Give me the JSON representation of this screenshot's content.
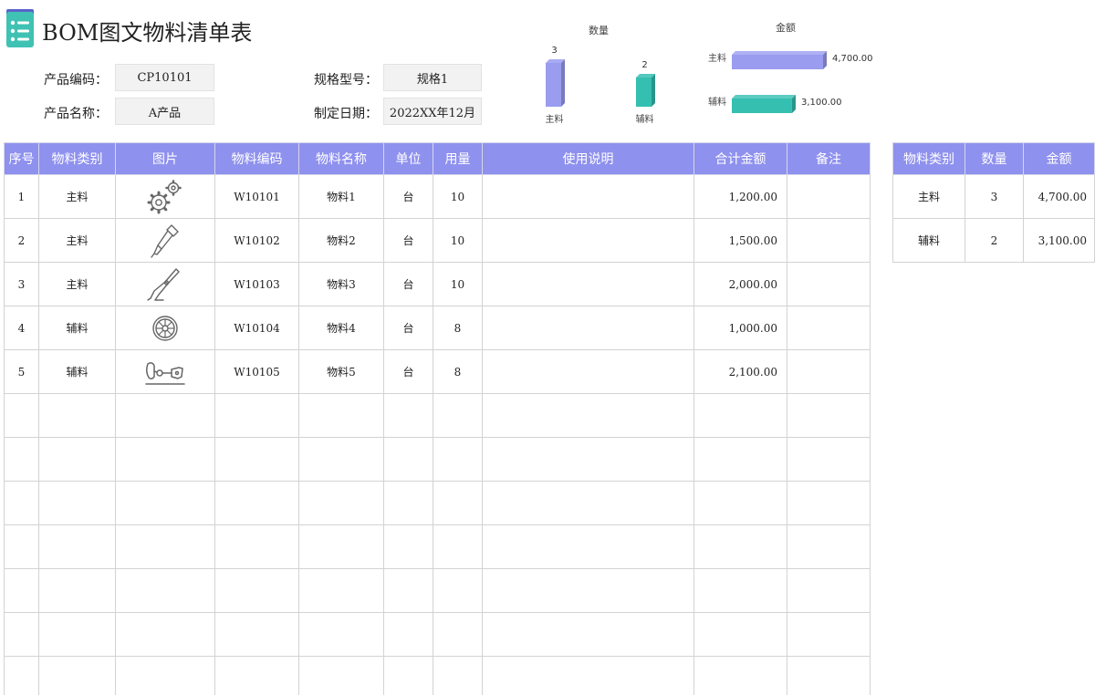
{
  "title": "BOM图文物料清单表",
  "info": {
    "product_code_label": "产品编码：",
    "product_code_value": "CP10101",
    "spec_label": "规格型号：",
    "spec_value": "规格1",
    "product_name_label": "产品名称：",
    "product_name_value": "A产品",
    "date_label": "制定日期：",
    "date_value": "2022XX年12月"
  },
  "colors": {
    "header": "#8f91ee",
    "series_main": "#9a9cf0",
    "series_aux": "#35bfb1"
  },
  "chart_data": [
    {
      "type": "bar",
      "title": "数量",
      "categories": [
        "主料",
        "辅料"
      ],
      "values": [
        3,
        2
      ],
      "data_labels": [
        "3",
        "2"
      ],
      "ylim": [
        0,
        3
      ]
    },
    {
      "type": "bar",
      "orientation": "horizontal",
      "title": "金额",
      "categories": [
        "主料",
        "辅料"
      ],
      "values": [
        4700,
        3100
      ],
      "data_labels": [
        "4,700.00",
        "3,100.00"
      ],
      "xlim": [
        0,
        4700
      ]
    }
  ],
  "table": {
    "headers": [
      "序号",
      "物料类别",
      "图片",
      "物料编码",
      "物料名称",
      "单位",
      "用量",
      "使用说明",
      "合计金额",
      "备注"
    ],
    "rows": [
      {
        "no": "1",
        "category": "主料",
        "icon": "gears-icon",
        "code": "W10101",
        "name": "物料1",
        "unit": "台",
        "qty": "10",
        "desc": "",
        "amount": "1,200.00",
        "note": ""
      },
      {
        "no": "2",
        "category": "主料",
        "icon": "pen-tool-icon",
        "code": "W10102",
        "name": "物料2",
        "unit": "台",
        "qty": "10",
        "desc": "",
        "amount": "1,500.00",
        "note": ""
      },
      {
        "no": "3",
        "category": "主料",
        "icon": "pliers-icon",
        "code": "W10103",
        "name": "物料3",
        "unit": "台",
        "qty": "10",
        "desc": "",
        "amount": "2,000.00",
        "note": ""
      },
      {
        "no": "4",
        "category": "辅料",
        "icon": "wheel-icon",
        "code": "W10104",
        "name": "物料4",
        "unit": "台",
        "qty": "8",
        "desc": "",
        "amount": "1,000.00",
        "note": ""
      },
      {
        "no": "5",
        "category": "辅料",
        "icon": "chain-link-icon",
        "code": "W10105",
        "name": "物料5",
        "unit": "台",
        "qty": "8",
        "desc": "",
        "amount": "2,100.00",
        "note": ""
      }
    ],
    "empty_rows": 7
  },
  "summary": {
    "headers": [
      "物料类别",
      "数量",
      "金额"
    ],
    "rows": [
      {
        "category": "主料",
        "qty": "3",
        "amount": "4,700.00"
      },
      {
        "category": "辅料",
        "qty": "2",
        "amount": "3,100.00"
      }
    ]
  }
}
